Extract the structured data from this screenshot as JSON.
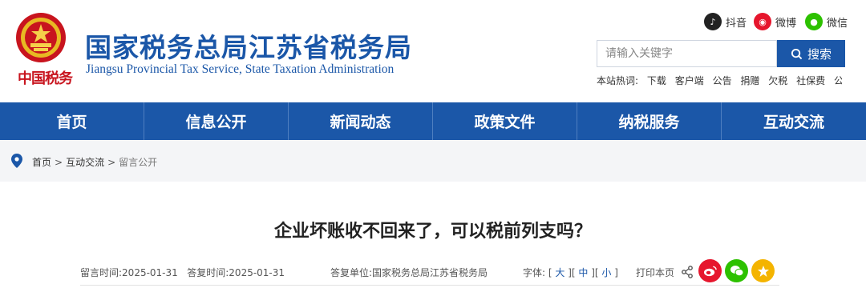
{
  "site": {
    "title": "国家税务总局江苏省税务局",
    "subtitle": "Jiangsu Provincial Tax Service, State Taxation Administration",
    "calligraphy": "中国税务"
  },
  "social": [
    {
      "label": "抖音",
      "icon": "douyin-icon",
      "color": "#222222"
    },
    {
      "label": "微博",
      "icon": "weibo-icon",
      "color": "#e6162d"
    },
    {
      "label": "微信",
      "icon": "wechat-icon",
      "color": "#2dc100"
    }
  ],
  "search": {
    "placeholder": "请输入关键字",
    "button": "搜索"
  },
  "hot": {
    "label": "本站热词:",
    "items": [
      "下载",
      "客户端",
      "公告",
      "捐赠",
      "欠税",
      "社保费",
      "公"
    ]
  },
  "nav": [
    "首页",
    "信息公开",
    "新闻动态",
    "政策文件",
    "纳税服务",
    "互动交流"
  ],
  "breadcrumb": [
    "首页",
    "互动交流",
    "留言公开"
  ],
  "article": {
    "title": "企业坏账收不回来了，可以税前列支吗？",
    "msg_time_label": "留言时间:",
    "msg_time": "2025-01-31",
    "reply_time_label": "答复时间:",
    "reply_time": "2025-01-31",
    "unit_label": "答复单位:",
    "unit": "国家税务总局江苏省税务局",
    "font_label": "字体:",
    "font_large": "大",
    "font_medium": "中",
    "font_small": "小",
    "print": "打印本页"
  },
  "colors": {
    "brand": "#1b57a8",
    "emblem_red": "#c8141e",
    "crumb_bg": "#f4f5f7"
  }
}
